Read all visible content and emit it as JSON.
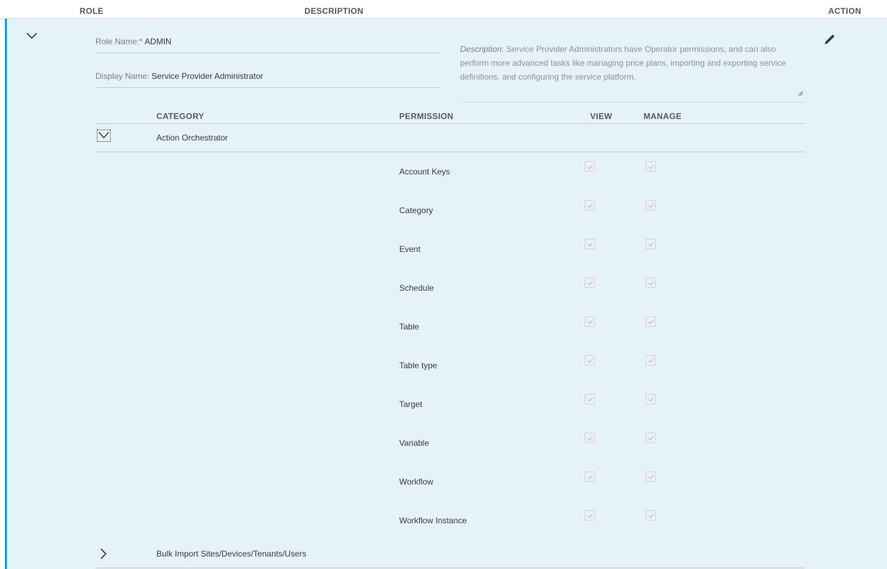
{
  "columns": {
    "role": "ROLE",
    "description": "DESCRIPTION",
    "action": "ACTION"
  },
  "role": {
    "role_name_label": "Role Name:*",
    "role_name_value": "ADMIN",
    "display_name_label": "Display Name:",
    "display_name_value": "Service Provider Administrator",
    "description_label": "Description:",
    "description_text": "Service Provider Administrators have Operator permissions, and can also perform more advanced tasks like managing price plans, importing and exporting service definitions, and configuring the service platform."
  },
  "table": {
    "headers": {
      "category": "CATEGORY",
      "permission": "PERMISSION",
      "view": "VIEW",
      "manage": "MANAGE"
    },
    "categories": [
      {
        "name": "Action Orchestrator",
        "expanded": true,
        "permissions": [
          {
            "name": "Account Keys",
            "view": true,
            "manage": true
          },
          {
            "name": "Category",
            "view": true,
            "manage": true
          },
          {
            "name": "Event",
            "view": true,
            "manage": true
          },
          {
            "name": "Schedule",
            "view": true,
            "manage": true
          },
          {
            "name": "Table",
            "view": true,
            "manage": true
          },
          {
            "name": "Table type",
            "view": true,
            "manage": true
          },
          {
            "name": "Target",
            "view": true,
            "manage": true
          },
          {
            "name": "Variable",
            "view": true,
            "manage": true
          },
          {
            "name": "Workflow",
            "view": true,
            "manage": true
          },
          {
            "name": "Workflow Instance",
            "view": true,
            "manage": true
          }
        ]
      },
      {
        "name": "Bulk Import Sites/Devices/Tenants/Users",
        "expanded": false
      }
    ]
  },
  "icons": {
    "collapse": "chevron-down-icon",
    "expand": "chevron-right-icon",
    "edit": "pencil-icon",
    "check": "checkmark-icon"
  },
  "colors": {
    "accent": "#049fd9",
    "panel_background": "#e6f2fa"
  }
}
